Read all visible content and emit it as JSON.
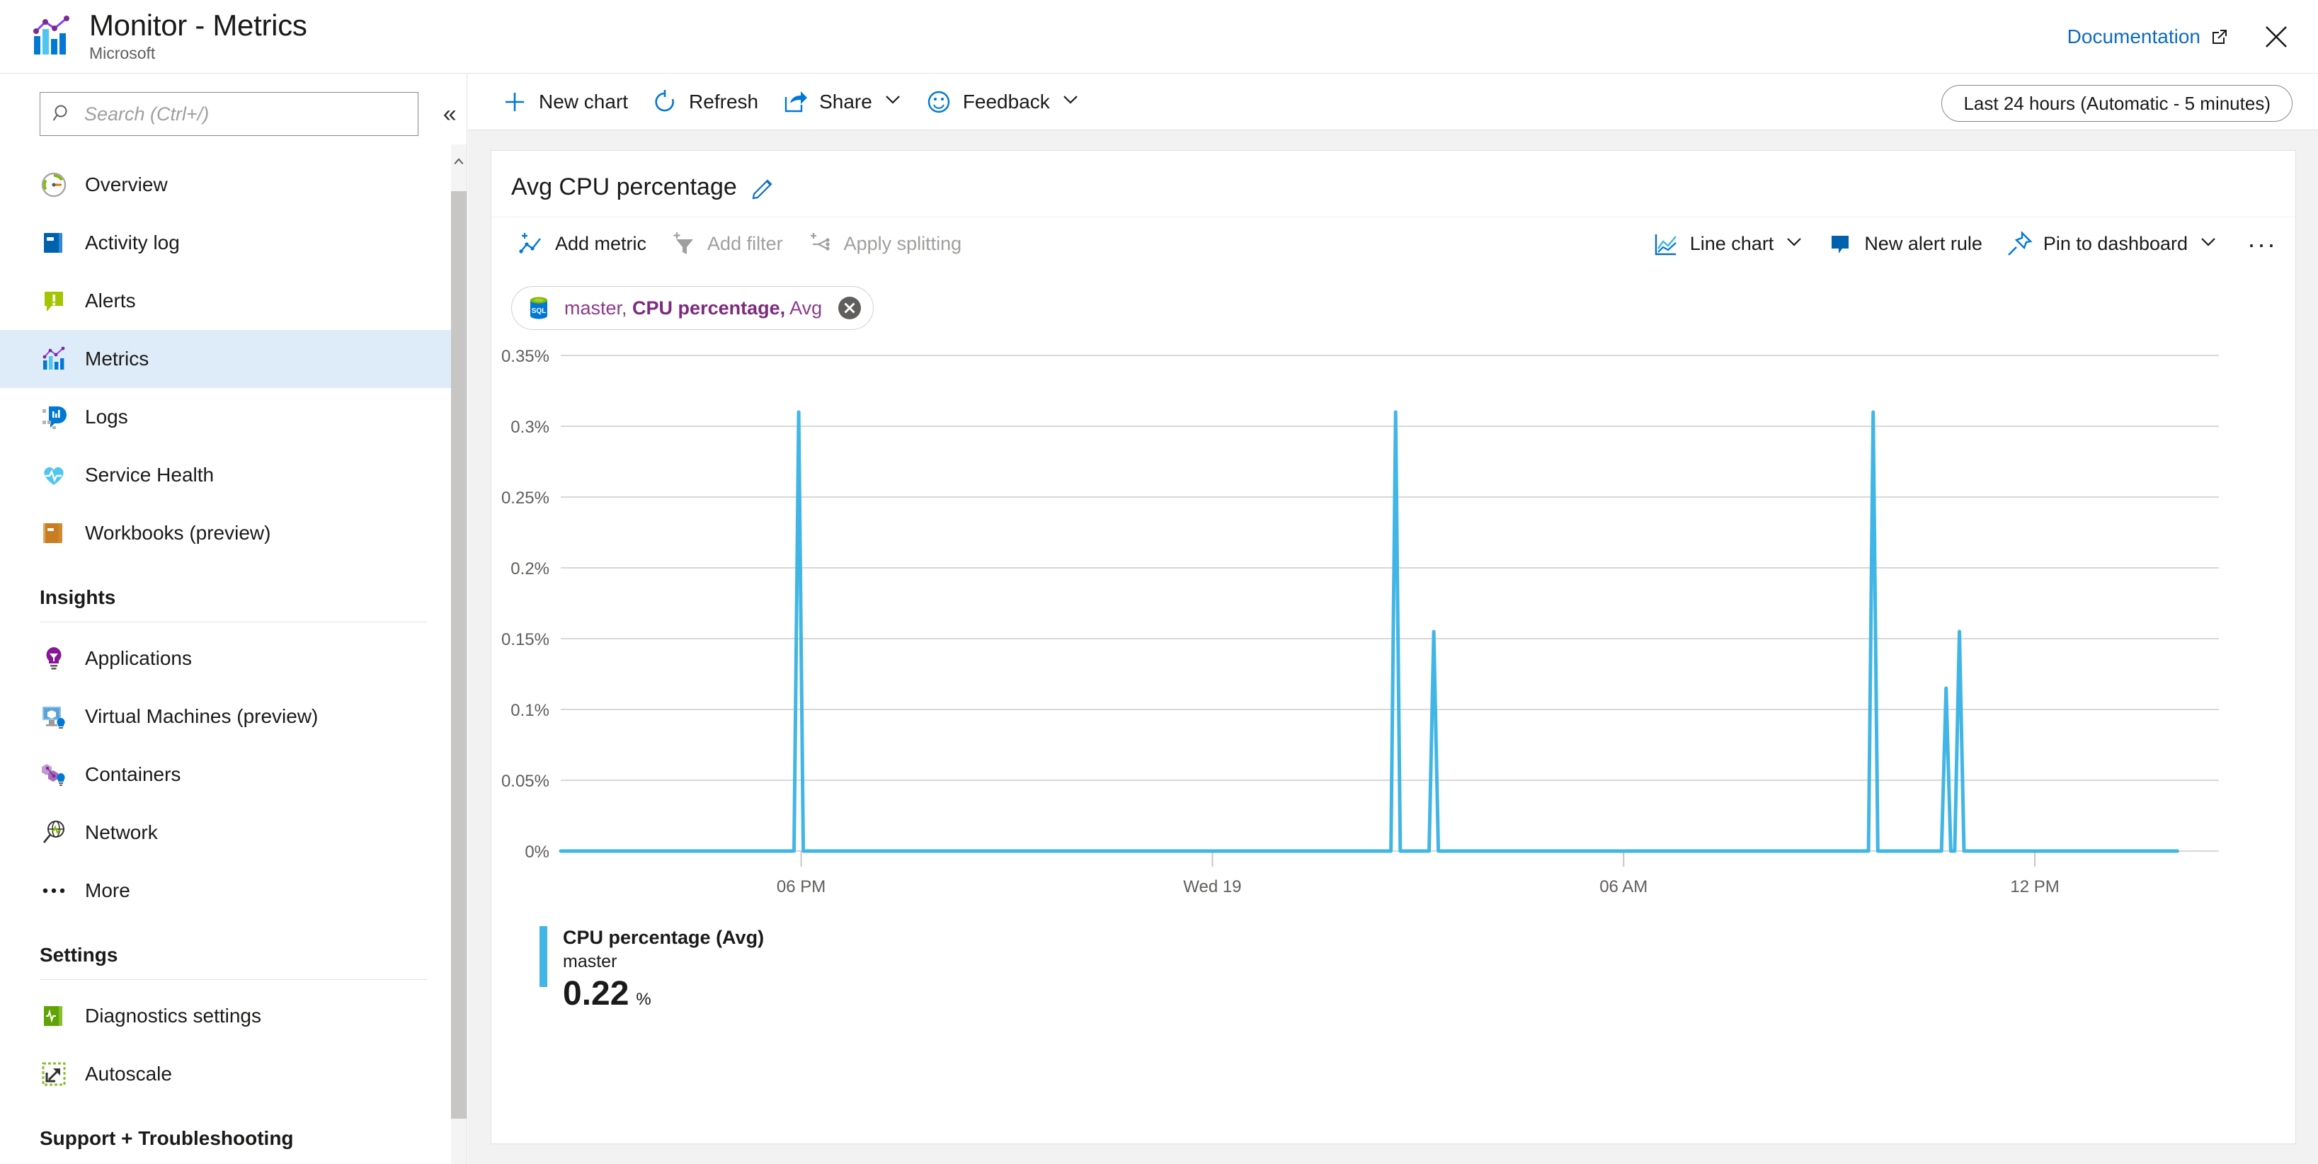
{
  "titlebar": {
    "title": "Monitor - Metrics",
    "subtitle": "Microsoft",
    "documentation_label": "Documentation",
    "close_label": "✕"
  },
  "sidebar": {
    "search": {
      "placeholder": "Search (Ctrl+/)",
      "value": ""
    },
    "collapse_label": "«",
    "items": [
      {
        "label": "Overview",
        "icon": "gauge-icon",
        "selected": false
      },
      {
        "label": "Activity log",
        "icon": "book-blue-icon",
        "selected": false
      },
      {
        "label": "Alerts",
        "icon": "alert-green-icon",
        "selected": false
      },
      {
        "label": "Metrics",
        "icon": "metrics-chart-icon",
        "selected": true
      },
      {
        "label": "Logs",
        "icon": "logs-icon",
        "selected": false
      },
      {
        "label": "Service Health",
        "icon": "heart-pulse-icon",
        "selected": false
      },
      {
        "label": "Workbooks (preview)",
        "icon": "workbook-orange-icon",
        "selected": false
      }
    ],
    "sections": [
      {
        "title": "Insights",
        "items": [
          {
            "label": "Applications",
            "icon": "lightbulb-purple-icon"
          },
          {
            "label": "Virtual Machines (preview)",
            "icon": "vm-insights-icon"
          },
          {
            "label": "Containers",
            "icon": "containers-icon"
          },
          {
            "label": "Network",
            "icon": "network-globe-icon"
          },
          {
            "label": "More",
            "icon": "more-dots-icon"
          }
        ]
      },
      {
        "title": "Settings",
        "items": [
          {
            "label": "Diagnostics settings",
            "icon": "diagnostics-green-icon"
          },
          {
            "label": "Autoscale",
            "icon": "autoscale-icon"
          }
        ]
      }
    ],
    "footer_section": "Support + Troubleshooting"
  },
  "toolbar": {
    "new_chart": "New chart",
    "refresh": "Refresh",
    "share": "Share",
    "feedback": "Feedback",
    "time_range": "Last 24 hours (Automatic - 5 minutes)"
  },
  "chart_panel": {
    "title": "Avg CPU percentage",
    "commands": {
      "add_metric": "Add metric",
      "add_filter": "Add filter",
      "apply_splitting": "Apply splitting",
      "chart_type": "Line chart",
      "new_alert_rule": "New alert rule",
      "pin_to_dashboard": "Pin to dashboard",
      "more": "···"
    },
    "metric_chip": {
      "resource": "master,",
      "metric": "CPU percentage,",
      "aggregation": "Avg",
      "remove_label": "✕"
    },
    "legend": {
      "name": "CPU percentage (Avg)",
      "resource": "master",
      "value": "0.22",
      "unit": "%",
      "color": "#41b6e6"
    }
  },
  "chart_data": {
    "type": "line",
    "title": "Avg CPU percentage",
    "xlabel": "",
    "ylabel": "",
    "series_name": "CPU percentage (Avg)",
    "series_resource": "master",
    "color": "#41b6e6",
    "grid": true,
    "legend_position": "bottom-left",
    "ylim": [
      0,
      0.35
    ],
    "ytick_labels": [
      "0.35%",
      "0.3%",
      "0.25%",
      "0.2%",
      "0.15%",
      "0.1%",
      "0.05%",
      "0%"
    ],
    "ytick_values": [
      0.35,
      0.3,
      0.25,
      0.2,
      0.15,
      0.1,
      0.05,
      0
    ],
    "xtick_labels": [
      "06 PM",
      "Wed 19",
      "06 AM",
      "12 PM"
    ],
    "xtick_positions": [
      0.145,
      0.393,
      0.641,
      0.889
    ],
    "baseline_value": 0,
    "spikes": [
      {
        "x": 0.1435,
        "y": 0.31
      },
      {
        "x": 0.5035,
        "y": 0.31
      },
      {
        "x": 0.5265,
        "y": 0.155
      },
      {
        "x": 0.7915,
        "y": 0.31
      },
      {
        "x": 0.8355,
        "y": 0.115
      },
      {
        "x": 0.8435,
        "y": 0.155
      }
    ],
    "note": "Flat line at 0% with narrow single-sample spikes"
  }
}
